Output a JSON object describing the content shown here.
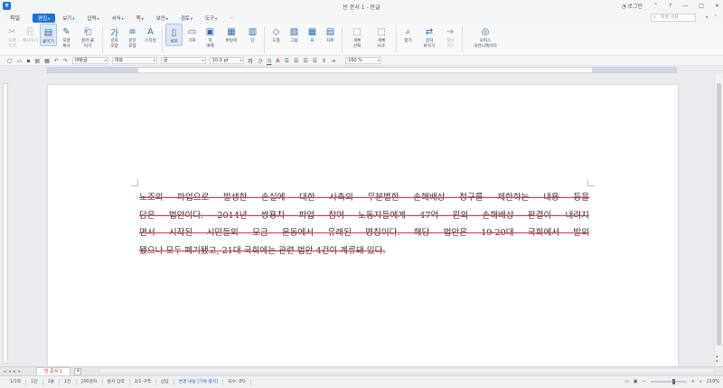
{
  "window": {
    "title": "빈 문서 1 - 한글",
    "login_label": "로그인"
  },
  "menubar": {
    "file_label": "파일",
    "items": [
      {
        "label": "편집",
        "active": true
      },
      {
        "label": "보기"
      },
      {
        "label": "입력"
      },
      {
        "label": "서식"
      },
      {
        "label": "쪽"
      },
      {
        "label": "보안"
      },
      {
        "label": "검토"
      },
      {
        "label": "도구"
      }
    ],
    "search_placeholder": "찾을 내용"
  },
  "ribbon": {
    "buttons": [
      {
        "name": "cut",
        "label": "오려\n두기",
        "icon": "✂",
        "dim": true
      },
      {
        "name": "copy",
        "label": "복사하기",
        "icon": "⎘",
        "dim": true
      },
      {
        "name": "paste",
        "label": "붙이기",
        "icon": "📋",
        "selected": true
      },
      {
        "name": "format-copy",
        "label": "모양\n복사",
        "icon": "🖌"
      },
      {
        "name": "paste-special",
        "label": "골라 붙\n이기",
        "icon": "⎗"
      },
      {
        "name": "char-shape",
        "label": "글자\n모양",
        "icon": "가"
      },
      {
        "name": "para-shape",
        "label": "문단\n모양",
        "icon": "≡"
      },
      {
        "name": "style",
        "label": "스타일",
        "icon": "A"
      },
      {
        "name": "sero",
        "label": "세로",
        "icon": "▯",
        "selected": true
      },
      {
        "name": "garo",
        "label": "가로",
        "icon": "▭"
      },
      {
        "name": "layout",
        "label": "쪽\n여백",
        "icon": "▣"
      },
      {
        "name": "multi-col",
        "label": "바탕쪽",
        "icon": "▦"
      },
      {
        "name": "columns",
        "label": "단",
        "icon": "▥"
      },
      {
        "name": "shape",
        "label": "도형",
        "icon": "◇"
      },
      {
        "name": "picture",
        "label": "그림",
        "icon": "▨"
      },
      {
        "name": "table",
        "label": "표",
        "icon": "▦"
      },
      {
        "name": "chart",
        "label": "차트",
        "icon": "▤"
      },
      {
        "name": "object-select",
        "label": "개체\n선택",
        "icon": "⬚"
      },
      {
        "name": "object-protect",
        "label": "개체\n보호",
        "icon": "⬚"
      },
      {
        "name": "find",
        "label": "찾기",
        "icon": "🔍"
      },
      {
        "name": "replace",
        "label": "글자\n바꾸기",
        "icon": "⇄"
      },
      {
        "name": "go",
        "label": "찾아\n가기",
        "icon": "➔",
        "dim": true
      },
      {
        "name": "office-community",
        "label": "오피스\n커뮤니케이터",
        "icon": "◎"
      }
    ]
  },
  "toolbar2": {
    "style_value": "바탕글",
    "lang_value": "대표",
    "font_value": "굴",
    "size_value": "10.0",
    "size_unit": "pt",
    "bold": "가",
    "italic": "가",
    "underline": "가",
    "zoom_value": "160",
    "zoom_unit": "%"
  },
  "document": {
    "lines": [
      "노조의 파업으로 발생한 손실에 대한 사측의 무분별한 손해배상 청구를 제한하는 내용 등을",
      "담은 법안이다. 2014년 쌍용차 파업 참여 노동자들에게 47억 원의 손해배상 판결이 내려지",
      "면서 시작된 시민들의 모금 운동에서 유래된 명칭이다. 해당 법안은 19·20대 국회에서 발의",
      "됐으나 모두 폐기됐고, 21대 국회에는 관련 법안 4건이 계류돼 있다."
    ],
    "strike_color": "#e0303c"
  },
  "tabs": {
    "doc_tab_label": "빈 문서 1"
  },
  "status": {
    "items": [
      {
        "text": "1/1쪽"
      },
      {
        "text": "1단"
      },
      {
        "text": "1줄"
      },
      {
        "text": "1칸"
      },
      {
        "text": "190글자"
      },
      {
        "text": "문자 입력"
      },
      {
        "text": "1/1 구역"
      },
      {
        "text": "삽입"
      },
      {
        "text": "변경 내용 [기록 중지]",
        "accent": true
      },
      {
        "text": "자수: 0타"
      }
    ],
    "zoom_label": "210%"
  }
}
